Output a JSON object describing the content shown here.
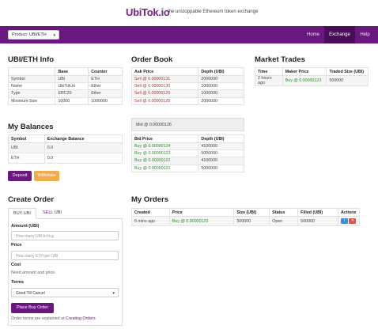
{
  "header": {
    "logo_main": "UbiTok",
    "logo_suffix": ".io",
    "tagline": "the unstoppable Ethereum token exchange"
  },
  "navbar": {
    "product_selector": "Product: UBI/ETH",
    "items": [
      "Home",
      "Exchange",
      "Help"
    ]
  },
  "info": {
    "title": "UBI/ETH Info",
    "columns": [
      "",
      "Base",
      "Counter"
    ],
    "rows": [
      [
        "Symbol",
        "UBI",
        "ETH"
      ],
      [
        "Name",
        "UbiTok.io",
        "Ether"
      ],
      [
        "Type",
        "ERC20",
        "Ether"
      ],
      [
        "Minimum Size",
        "10000",
        "1000000"
      ]
    ]
  },
  "balances": {
    "title": "My Balances",
    "columns": [
      "Symbol",
      "Exchange Balance"
    ],
    "rows": [
      [
        "UBI",
        "0.0"
      ],
      [
        "ETH",
        "0.0"
      ]
    ],
    "deposit_label": "Deposit",
    "withdraw_label": "Withdraw"
  },
  "create_order": {
    "title": "Create Order",
    "tabs": [
      "BUY UBI",
      "SELL UBI"
    ],
    "amount_label": "Amount (UBI)",
    "amount_placeholder": "How many UBI to buy",
    "price_label": "Price",
    "price_placeholder": "How many ETH per UBI",
    "cost_label": "Cost",
    "cost_note": "Need amount and price.",
    "terms_label": "Terms",
    "terms_value": "Good Till Cancel",
    "place_label": "Place Buy Order",
    "terms_note_prefix": "Order terms are explained at",
    "terms_note_link": "Creating Orders"
  },
  "order_book": {
    "title": "Order Book",
    "ask_columns": [
      "Ask Price",
      "Depth (UBI)"
    ],
    "asks": [
      [
        "Sell @ 0.00000131",
        "2000000"
      ],
      [
        "Sell @ 0.00000130",
        "1000000"
      ],
      [
        "Sell @ 0.00000129",
        "1000000"
      ],
      [
        "Sell @ 0.00000128",
        "2000000"
      ]
    ],
    "mid": "Mid @ 0.00000126",
    "bid_columns": [
      "Bid Price",
      "Depth (UBI)"
    ],
    "bids": [
      [
        "Buy @ 0.00000124",
        "4100000"
      ],
      [
        "Buy @ 0.00000123",
        "5000000"
      ],
      [
        "Buy @ 0.00000122",
        "4100000"
      ],
      [
        "Buy @ 0.00000121",
        "5000000"
      ]
    ]
  },
  "my_orders": {
    "title": "My Orders",
    "columns": [
      "Created",
      "Price",
      "Size (UBI)",
      "Status",
      "Filled (UBI)",
      "Actions"
    ],
    "rows": [
      [
        "5 mins ago",
        "Buy @ 0.00000123",
        "500000",
        "Open",
        "500000"
      ]
    ]
  },
  "market_trades": {
    "title": "Market Trades",
    "columns": [
      "Time",
      "Maker Price",
      "Traded Size (UBI)"
    ],
    "rows": [
      [
        "2 hours ago",
        "Buy @ 0.00000123",
        "500000"
      ]
    ]
  }
}
